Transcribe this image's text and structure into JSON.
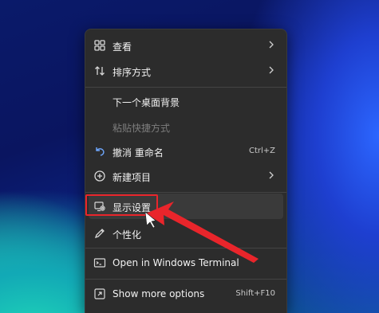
{
  "menu": {
    "items": [
      {
        "label": "查看",
        "icon": "grid-icon",
        "submenu": true
      },
      {
        "label": "排序方式",
        "icon": "sort-icon",
        "submenu": true
      },
      {
        "label": "下一个桌面背景"
      },
      {
        "label": "粘贴快捷方式",
        "disabled": true
      },
      {
        "label": "撤消 重命名",
        "icon": "undo-icon",
        "shortcut": "Ctrl+Z"
      },
      {
        "label": "新建项目",
        "icon": "new-item-icon",
        "submenu": true
      },
      {
        "label": "显示设置",
        "icon": "display-settings-icon",
        "highlighted": true
      },
      {
        "label": "个性化",
        "icon": "personalize-pen-icon"
      },
      {
        "label": "Open in Windows Terminal",
        "icon": "terminal-icon"
      },
      {
        "label": "Show more options",
        "icon": "more-options-icon",
        "shortcut": "Shift+F10"
      }
    ]
  },
  "annotation": {
    "color": "#e9252b"
  }
}
